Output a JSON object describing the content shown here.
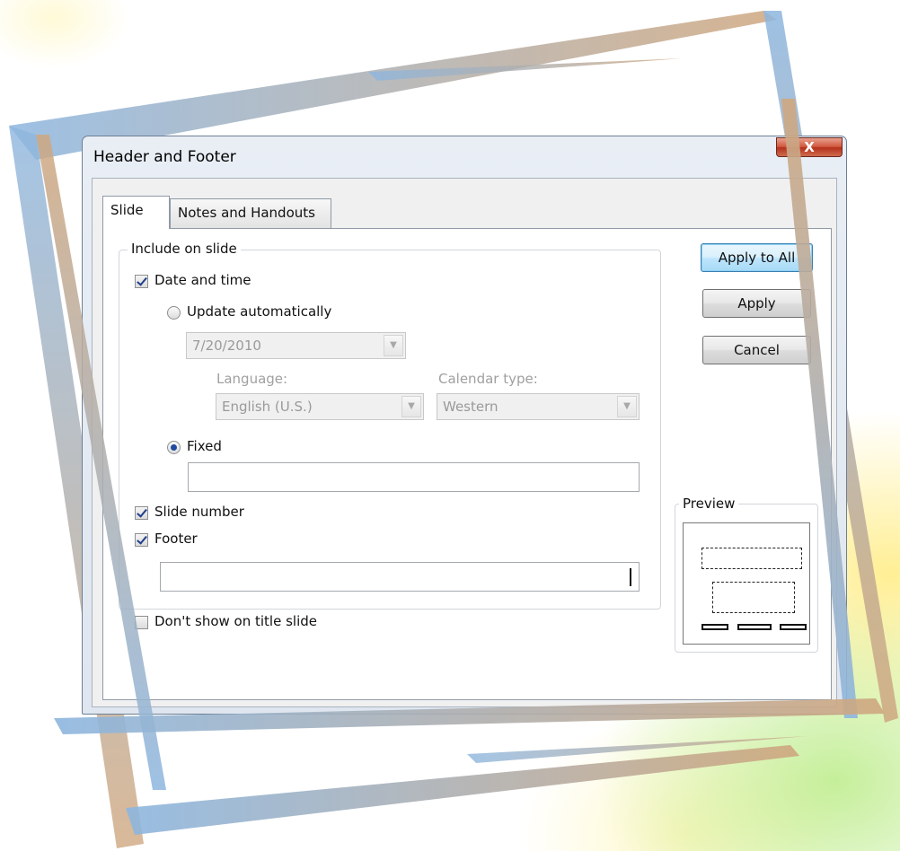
{
  "dialog": {
    "title": "Header and Footer",
    "close_symbol": "X"
  },
  "tabs": [
    {
      "label": "Slide",
      "selected": true
    },
    {
      "label": "Notes and Handouts",
      "selected": false
    }
  ],
  "include_group": {
    "legend": "Include on slide",
    "date_and_time": {
      "label": "Date and time",
      "checked": true
    },
    "update_automatically": {
      "label": "Update automatically",
      "selected": false
    },
    "date_combo": {
      "value": "7/20/2010"
    },
    "language": {
      "label": "Language:",
      "value": "English (U.S.)"
    },
    "calendar_type": {
      "label": "Calendar type:",
      "value": "Western"
    },
    "fixed": {
      "label": "Fixed",
      "selected": true,
      "value": ""
    },
    "slide_number": {
      "label": "Slide number",
      "checked": true
    },
    "footer": {
      "label": "Footer",
      "checked": true,
      "value": ""
    }
  },
  "dont_show_title": {
    "label": "Don't show on title slide",
    "checked": false
  },
  "buttons": {
    "apply_to_all": "Apply to All",
    "apply": "Apply",
    "cancel": "Cancel"
  },
  "preview": {
    "legend": "Preview"
  },
  "colors": {
    "close_button": "#c8472e",
    "default_button_border": "#3c7fb1",
    "frame_blue": "#8fb3d9",
    "frame_tan": "#c9a27a"
  },
  "icons": [
    "close-icon",
    "dropdown-arrow-icon"
  ]
}
